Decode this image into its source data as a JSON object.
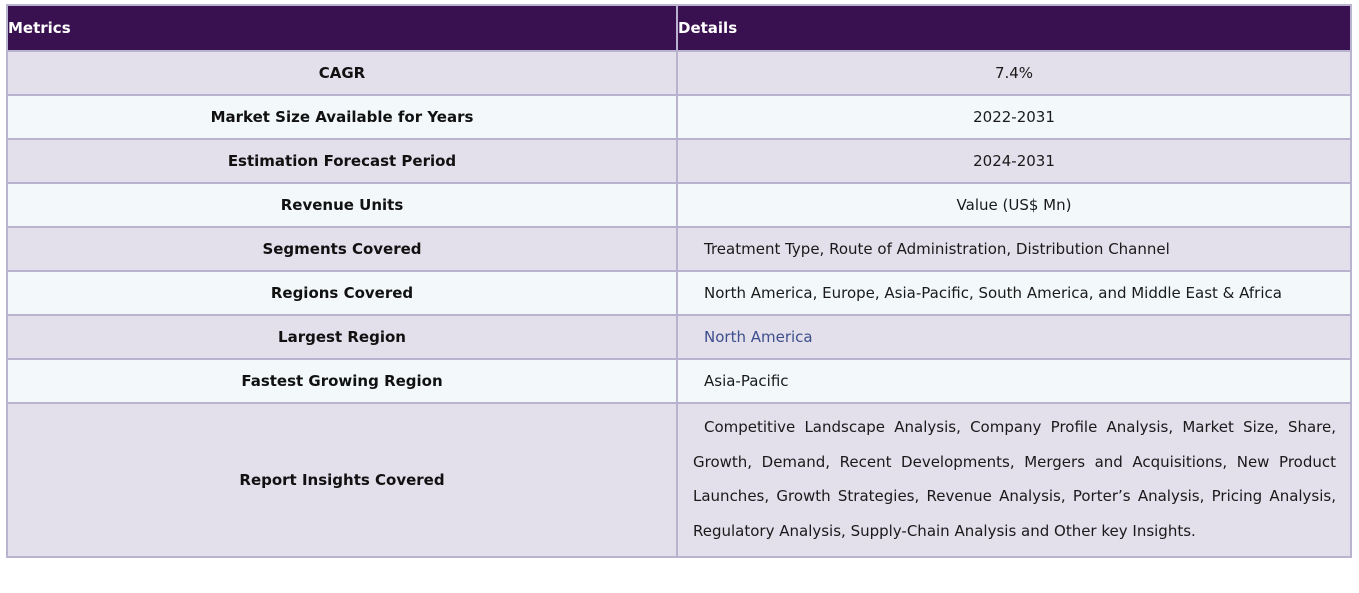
{
  "header": {
    "metrics_label": "Metrics",
    "details_label": "Details"
  },
  "rows": [
    {
      "metric": "CAGR",
      "detail": "7.4%"
    },
    {
      "metric": "Market Size Available for Years",
      "detail": "2022-2031"
    },
    {
      "metric": "Estimation Forecast Period",
      "detail": "2024-2031"
    },
    {
      "metric": "Revenue Units",
      "detail": "Value (US$ Mn)"
    },
    {
      "metric": "Segments Covered",
      "detail": "Treatment Type, Route of Administration, Distribution Channel"
    },
    {
      "metric": "Regions Covered",
      "detail": "North America, Europe, Asia-Pacific, South America, and Middle East & Africa"
    },
    {
      "metric": "Largest Region",
      "detail": "North America"
    },
    {
      "metric": "Fastest Growing Region",
      "detail": "Asia-Pacific"
    },
    {
      "metric": "Report Insights Covered",
      "detail": "Competitive Landscape Analysis, Company Profile Analysis, Market Size, Share, Growth, Demand, Recent Developments, Mergers and Acquisitions, New Product Launches, Growth Strategies, Revenue Analysis, Porter’s Analysis, Pricing Analysis, Regulatory Analysis, Supply-Chain Analysis and Other key Insights."
    }
  ],
  "colors": {
    "header_bg": "#3a1150",
    "row_odd_bg": "#e3dfeb",
    "row_even_bg": "#f3f9fb",
    "border": "#b9b3d0",
    "link_text": "#3d4f8c"
  }
}
